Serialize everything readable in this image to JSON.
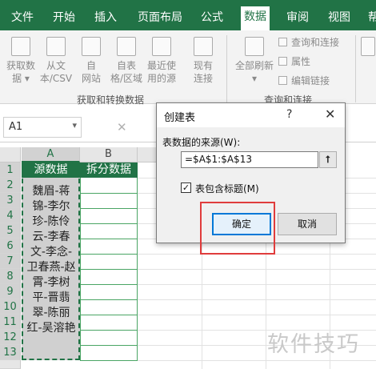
{
  "menu": {
    "items": [
      "文件",
      "开始",
      "插入",
      "页面布局",
      "公式",
      "数据",
      "审阅",
      "视图",
      "帮"
    ],
    "active": "数据"
  },
  "ribbon": {
    "get_transform_group": {
      "label": "获取和转换数据",
      "buttons": [
        {
          "label": "获取数\n据 ▾",
          "icon": "database-icon"
        },
        {
          "label": "从文\n本/CSV",
          "icon": "text-file-icon"
        },
        {
          "label": "自\n网站",
          "icon": "web-icon"
        },
        {
          "label": "自表\n格/区域",
          "icon": "table-icon"
        },
        {
          "label": "最近使\n用的源",
          "icon": "recent-source-icon"
        },
        {
          "label": "现有\n连接",
          "icon": "existing-connection-icon"
        }
      ]
    },
    "queries_group": {
      "label": "查询和连接",
      "refresh_all": {
        "label": "全部刷新\n▾",
        "icon": "refresh-icon"
      },
      "small_items": [
        "查询和连接",
        "属性",
        "编辑链接"
      ]
    }
  },
  "formula_bar": {
    "name_box": "A1"
  },
  "grid": {
    "columns": [
      "A",
      "B"
    ],
    "rows": [
      "1",
      "2",
      "3",
      "4",
      "5",
      "6",
      "7",
      "8",
      "9",
      "10",
      "11",
      "12",
      "13"
    ],
    "header_a": "源数据",
    "header_b": "拆分数据",
    "cell_a_text": "魏眉-蒋锦-李尔珍-陈伶云-李春文-李念-卫春燕-赵霄-李树平-晋翡翠-陈丽红-吴溶艳"
  },
  "dialog": {
    "title": "创建表",
    "help": "?",
    "close": "✕",
    "source_label": "表数据的来源(W):",
    "range": "=$A$1:$A$13",
    "collapse": "⭡",
    "has_headers_label": "表包含标题(M)",
    "has_headers_checked": "✓",
    "ok": "确定",
    "cancel": "取消"
  },
  "watermark": "软件技巧",
  "colors": {
    "accent": "#217346",
    "highlight": "#e03c3c",
    "ok_border": "#0078d7"
  }
}
